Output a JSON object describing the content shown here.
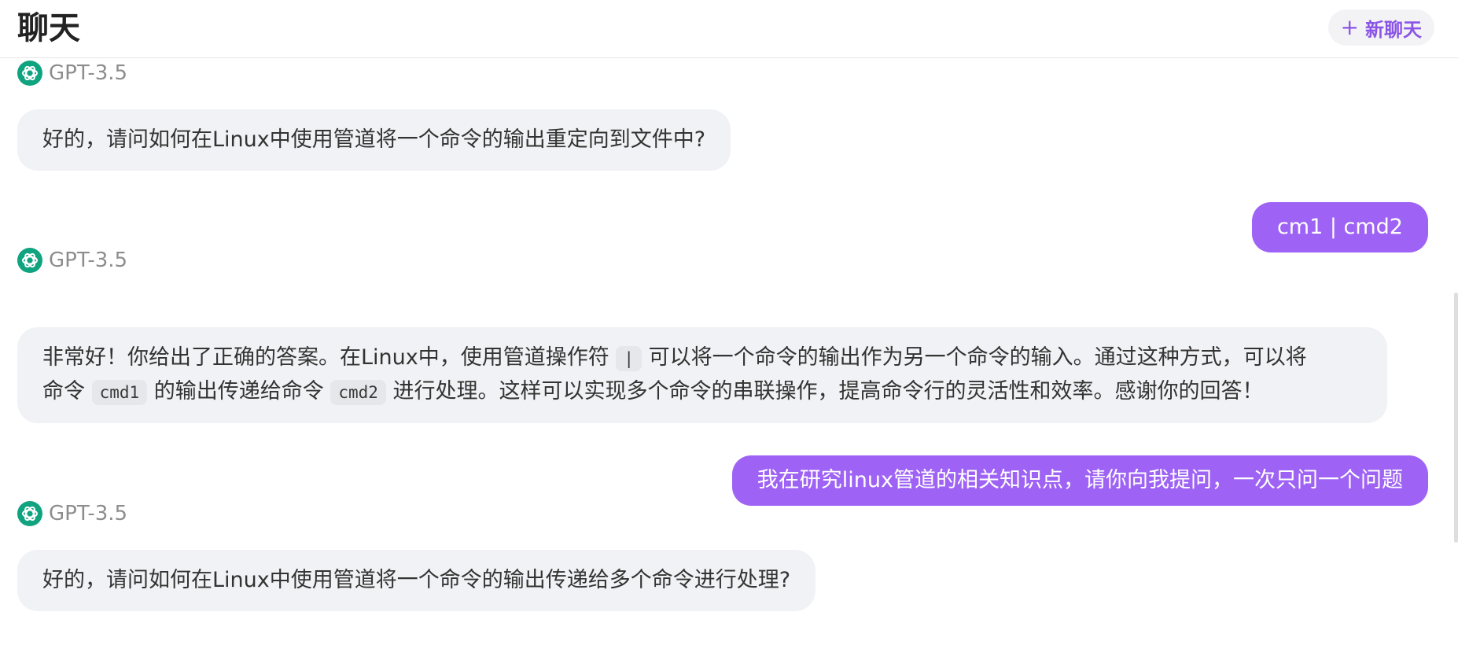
{
  "header": {
    "title": "聊天",
    "new_chat_plus": "+",
    "new_chat_label": "新聊天"
  },
  "colors": {
    "accent": "#9e63f4",
    "new_chat_text": "#8a55e6",
    "assistant_bubble": "#f1f2f5",
    "openai_icon": "#10a37f"
  },
  "messages": [
    {
      "role": "assistant",
      "model": "GPT-3.5",
      "icon": "openai-icon",
      "text": "好的，请问如何在Linux中使用管道将一个命令的输出重定向到文件中?"
    },
    {
      "role": "user",
      "text": "cm1 | cmd2"
    },
    {
      "role": "assistant",
      "model": "GPT-3.5",
      "icon": "openai-icon",
      "line1_a": "非常好！你给出了正确的答案。在Linux中，使用管道操作符 ",
      "code_pipe": "|",
      "line1_b": " 可以将一个命令的输出作为另一个命令的输入。通过这种方式，可以将",
      "line2_a": "命令 ",
      "code_cmd1": "cmd1",
      "line2_b": " 的输出传递给命令 ",
      "code_cmd2": "cmd2",
      "line2_c": " 进行处理。这样可以实现多个命令的串联操作，提高命令行的灵活性和效率。感谢你的回答！"
    },
    {
      "role": "user",
      "text": "我在研究linux管道的相关知识点，请你向我提问，一次只问一个问题"
    },
    {
      "role": "assistant",
      "model": "GPT-3.5",
      "icon": "openai-icon",
      "text": "好的，请问如何在Linux中使用管道将一个命令的输出传递给多个命令进行处理?"
    }
  ]
}
